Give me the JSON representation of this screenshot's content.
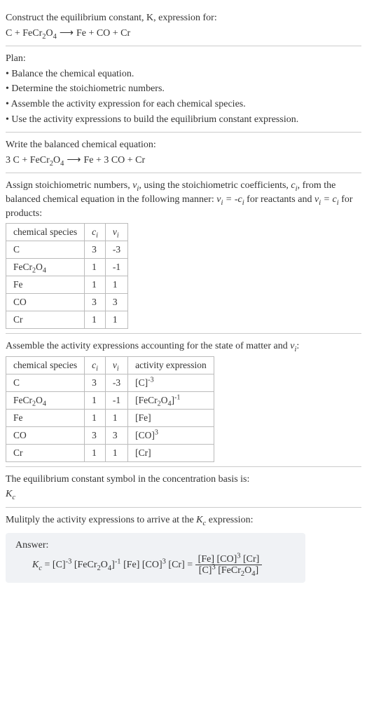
{
  "intro": {
    "line1": "Construct the equilibrium constant, K, expression for:",
    "eq": "C + FeCr₂O₄ ⟶ Fe + CO + Cr"
  },
  "plan": {
    "title": "Plan:",
    "b1": "• Balance the chemical equation.",
    "b2": "• Determine the stoichiometric numbers.",
    "b3": "• Assemble the activity expression for each chemical species.",
    "b4": "• Use the activity expressions to build the equilibrium constant expression."
  },
  "balanced": {
    "line1": "Write the balanced chemical equation:",
    "eq": "3 C + FeCr₂O₄ ⟶ Fe + 3 CO + Cr"
  },
  "assign": {
    "text_a": "Assign stoichiometric numbers, ",
    "nu": "νᵢ",
    "text_b": ", using the stoichiometric coefficients, ",
    "ci": "cᵢ",
    "text_c": ", from the balanced chemical equation in the following manner: ",
    "rel1": "νᵢ = -cᵢ",
    "text_d": " for reactants and ",
    "rel2": "νᵢ = cᵢ",
    "text_e": " for products:"
  },
  "table1": {
    "h1": "chemical species",
    "h2": "cᵢ",
    "h3": "νᵢ",
    "rows": [
      {
        "s": "C",
        "c": "3",
        "n": "-3"
      },
      {
        "s": "FeCr₂O₄",
        "c": "1",
        "n": "-1"
      },
      {
        "s": "Fe",
        "c": "1",
        "n": "1"
      },
      {
        "s": "CO",
        "c": "3",
        "n": "3"
      },
      {
        "s": "Cr",
        "c": "1",
        "n": "1"
      }
    ]
  },
  "assemble": {
    "text_a": "Assemble the activity expressions accounting for the state of matter and ",
    "nu": "νᵢ",
    "text_b": ":"
  },
  "table2": {
    "h1": "chemical species",
    "h2": "cᵢ",
    "h3": "νᵢ",
    "h4": "activity expression",
    "rows": [
      {
        "s": "C",
        "c": "3",
        "n": "-3",
        "a_base": "[C]",
        "a_exp": "-3"
      },
      {
        "s": "FeCr₂O₄",
        "c": "1",
        "n": "-1",
        "a_base": "[FeCr₂O₄]",
        "a_exp": "-1"
      },
      {
        "s": "Fe",
        "c": "1",
        "n": "1",
        "a_base": "[Fe]",
        "a_exp": ""
      },
      {
        "s": "CO",
        "c": "3",
        "n": "3",
        "a_base": "[CO]",
        "a_exp": "3"
      },
      {
        "s": "Cr",
        "c": "1",
        "n": "1",
        "a_base": "[Cr]",
        "a_exp": ""
      }
    ]
  },
  "symbol": {
    "line1": "The equilibrium constant symbol in the concentration basis is:",
    "kc": "K_c"
  },
  "multiply": {
    "text_a": "Mulitply the activity expressions to arrive at the ",
    "kc": "K_c",
    "text_b": " expression:"
  },
  "answer": {
    "label": "Answer:",
    "lhs": "K_c = ",
    "frac_num": "[Fe] [CO]³ [Cr]",
    "frac_den": "[C]³ [FeCr₂O₄]"
  }
}
